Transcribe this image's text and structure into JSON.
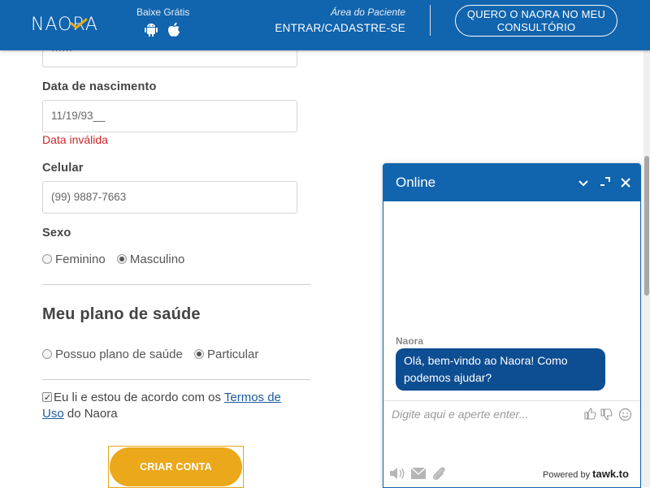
{
  "header": {
    "logo_text": "NAORA",
    "download_label": "Baixe Grátis",
    "patient_area_label": "Área do Paciente",
    "patient_link": "ENTRAR/CADASTRE-SE",
    "cta_line1": "QUERO O NAORA NO MEU",
    "cta_line2": "CONSULTÓRIO",
    "icons": [
      "android-icon",
      "apple-icon"
    ]
  },
  "form": {
    "password_value": "······",
    "birthdate_label": "Data de nascimento",
    "birthdate_value": "11/19/93__",
    "birthdate_error": "Data inválida",
    "phone_label": "Celular",
    "phone_placeholder": "(99) 9887-7663",
    "gender_label": "Sexo",
    "gender_options": [
      "Feminino",
      "Masculino"
    ],
    "gender_selected": "Masculino",
    "plan_section_title": "Meu plano de saúde",
    "plan_options": [
      "Possuo plano de saúde",
      "Particular"
    ],
    "plan_selected": "Particular",
    "terms_prefix": "Eu li e estou de acordo com os ",
    "terms_link": "Termos de Uso",
    "terms_suffix": " do Naora",
    "terms_checked": true,
    "submit_label": "CRIAR CONTA"
  },
  "chat": {
    "status": "Online",
    "agent_name": "Naora",
    "message_line1": "Olá, bem-vindo ao Naora! Como",
    "message_line2": "podemos ajudar?",
    "input_placeholder": "Digite aqui e aperte enter...",
    "powered_by": "Powered by",
    "brand": "tawk.to"
  },
  "colors": {
    "brand_blue": "#1164ae",
    "accent_orange": "#eaa81a",
    "error_red": "#d0262c",
    "bubble_blue": "#0d4d92"
  }
}
